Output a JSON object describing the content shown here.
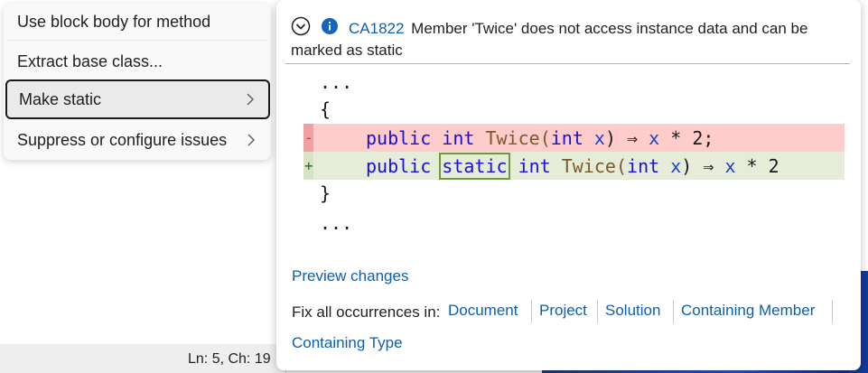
{
  "status_bar": {
    "position": "Ln: 5, Ch: 19"
  },
  "menu": {
    "items": [
      {
        "label": "Use block body for method"
      },
      {
        "label": "Extract base class..."
      },
      {
        "label": "Make static"
      },
      {
        "label": "Suppress or configure issues"
      }
    ]
  },
  "diagnostic": {
    "code": "CA1822",
    "message": "Member 'Twice' does not access instance data and can be marked as static"
  },
  "preview": {
    "ellipsis": "...",
    "open_brace": "{",
    "close_brace": "}",
    "removed_marker": "-",
    "added_marker": "+",
    "removed_line": {
      "kw1": "public",
      "kw2": "int",
      "method": "Twice",
      "p_open": "(",
      "p_type": "int",
      "p_name": "x",
      "p_close": ")",
      "arrow": "⇒",
      "expr_var": "x",
      "expr_rest": "* 2;"
    },
    "added_line": {
      "kw1": "public",
      "kw_static": "static",
      "kw2": "int",
      "method": "Twice",
      "p_open": "(",
      "p_type": "int",
      "p_name": "x",
      "p_close": ")",
      "arrow": "⇒",
      "expr_var": "x",
      "expr_rest": "* 2"
    }
  },
  "links": {
    "preview_changes": "Preview changes",
    "fix_all_label": "Fix all occurrences in:",
    "scopes": [
      "Document",
      "Project",
      "Solution",
      "Containing Member",
      "Containing Type"
    ]
  }
}
